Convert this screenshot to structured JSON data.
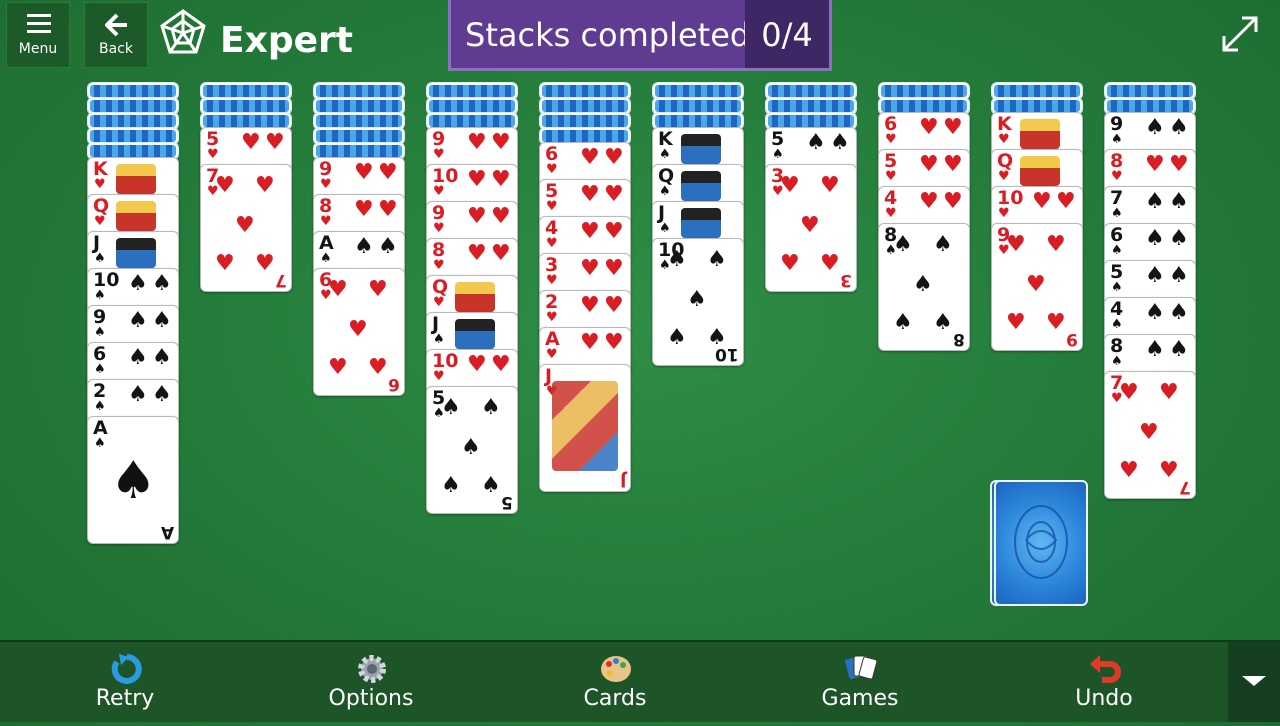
{
  "header": {
    "menu_label": "Menu",
    "back_label": "Back",
    "difficulty": "Expert",
    "stacks_label": "Stacks completed",
    "stacks_value": "0/4"
  },
  "tableau": [
    {
      "backs": 5,
      "cards": [
        {
          "rank": "K",
          "suit": "♥"
        },
        {
          "rank": "Q",
          "suit": "♥"
        },
        {
          "rank": "J",
          "suit": "♠"
        },
        {
          "rank": "10",
          "suit": "♠"
        },
        {
          "rank": "9",
          "suit": "♠"
        },
        {
          "rank": "6",
          "suit": "♠"
        },
        {
          "rank": "2",
          "suit": "♠"
        },
        {
          "rank": "A",
          "suit": "♠"
        }
      ]
    },
    {
      "backs": 3,
      "cards": [
        {
          "rank": "5",
          "suit": "♥"
        },
        {
          "rank": "7",
          "suit": "♥"
        }
      ]
    },
    {
      "backs": 5,
      "cards": [
        {
          "rank": "9",
          "suit": "♥"
        },
        {
          "rank": "8",
          "suit": "♥"
        },
        {
          "rank": "A",
          "suit": "♠"
        },
        {
          "rank": "6",
          "suit": "♥"
        }
      ]
    },
    {
      "backs": 3,
      "cards": [
        {
          "rank": "9",
          "suit": "♥"
        },
        {
          "rank": "10",
          "suit": "♥"
        },
        {
          "rank": "9",
          "suit": "♥"
        },
        {
          "rank": "8",
          "suit": "♥"
        },
        {
          "rank": "Q",
          "suit": "♥"
        },
        {
          "rank": "J",
          "suit": "♠"
        },
        {
          "rank": "10",
          "suit": "♥"
        },
        {
          "rank": "5",
          "suit": "♠"
        }
      ]
    },
    {
      "backs": 4,
      "cards": [
        {
          "rank": "6",
          "suit": "♥"
        },
        {
          "rank": "5",
          "suit": "♥"
        },
        {
          "rank": "4",
          "suit": "♥"
        },
        {
          "rank": "3",
          "suit": "♥"
        },
        {
          "rank": "2",
          "suit": "♥"
        },
        {
          "rank": "A",
          "suit": "♥"
        },
        {
          "rank": "J",
          "suit": "♥"
        }
      ]
    },
    {
      "backs": 3,
      "cards": [
        {
          "rank": "K",
          "suit": "♠"
        },
        {
          "rank": "Q",
          "suit": "♠"
        },
        {
          "rank": "J",
          "suit": "♠"
        },
        {
          "rank": "10",
          "suit": "♠"
        }
      ]
    },
    {
      "backs": 3,
      "cards": [
        {
          "rank": "5",
          "suit": "♠"
        },
        {
          "rank": "3",
          "suit": "♥"
        }
      ]
    },
    {
      "backs": 2,
      "cards": [
        {
          "rank": "6",
          "suit": "♥"
        },
        {
          "rank": "5",
          "suit": "♥"
        },
        {
          "rank": "4",
          "suit": "♥"
        },
        {
          "rank": "8",
          "suit": "♠"
        }
      ]
    },
    {
      "backs": 2,
      "cards": [
        {
          "rank": "K",
          "suit": "♥"
        },
        {
          "rank": "Q",
          "suit": "♥"
        },
        {
          "rank": "10",
          "suit": "♥"
        },
        {
          "rank": "9",
          "suit": "♥"
        }
      ]
    },
    {
      "backs": 2,
      "cards": [
        {
          "rank": "9",
          "suit": "♠"
        },
        {
          "rank": "8",
          "suit": "♥"
        },
        {
          "rank": "7",
          "suit": "♠"
        },
        {
          "rank": "6",
          "suit": "♠"
        },
        {
          "rank": "5",
          "suit": "♠"
        },
        {
          "rank": "4",
          "suit": "♠"
        },
        {
          "rank": "8",
          "suit": "♠"
        },
        {
          "rank": "7",
          "suit": "♥"
        }
      ]
    }
  ],
  "stock_piles": 2,
  "toolbar": {
    "retry": "Retry",
    "options": "Options",
    "cards": "Cards",
    "games": "Games",
    "undo": "Undo"
  },
  "colors": {
    "felt": "#237a39",
    "stacks_bg": "#5f3c91",
    "red_suit": "#d81e24"
  }
}
